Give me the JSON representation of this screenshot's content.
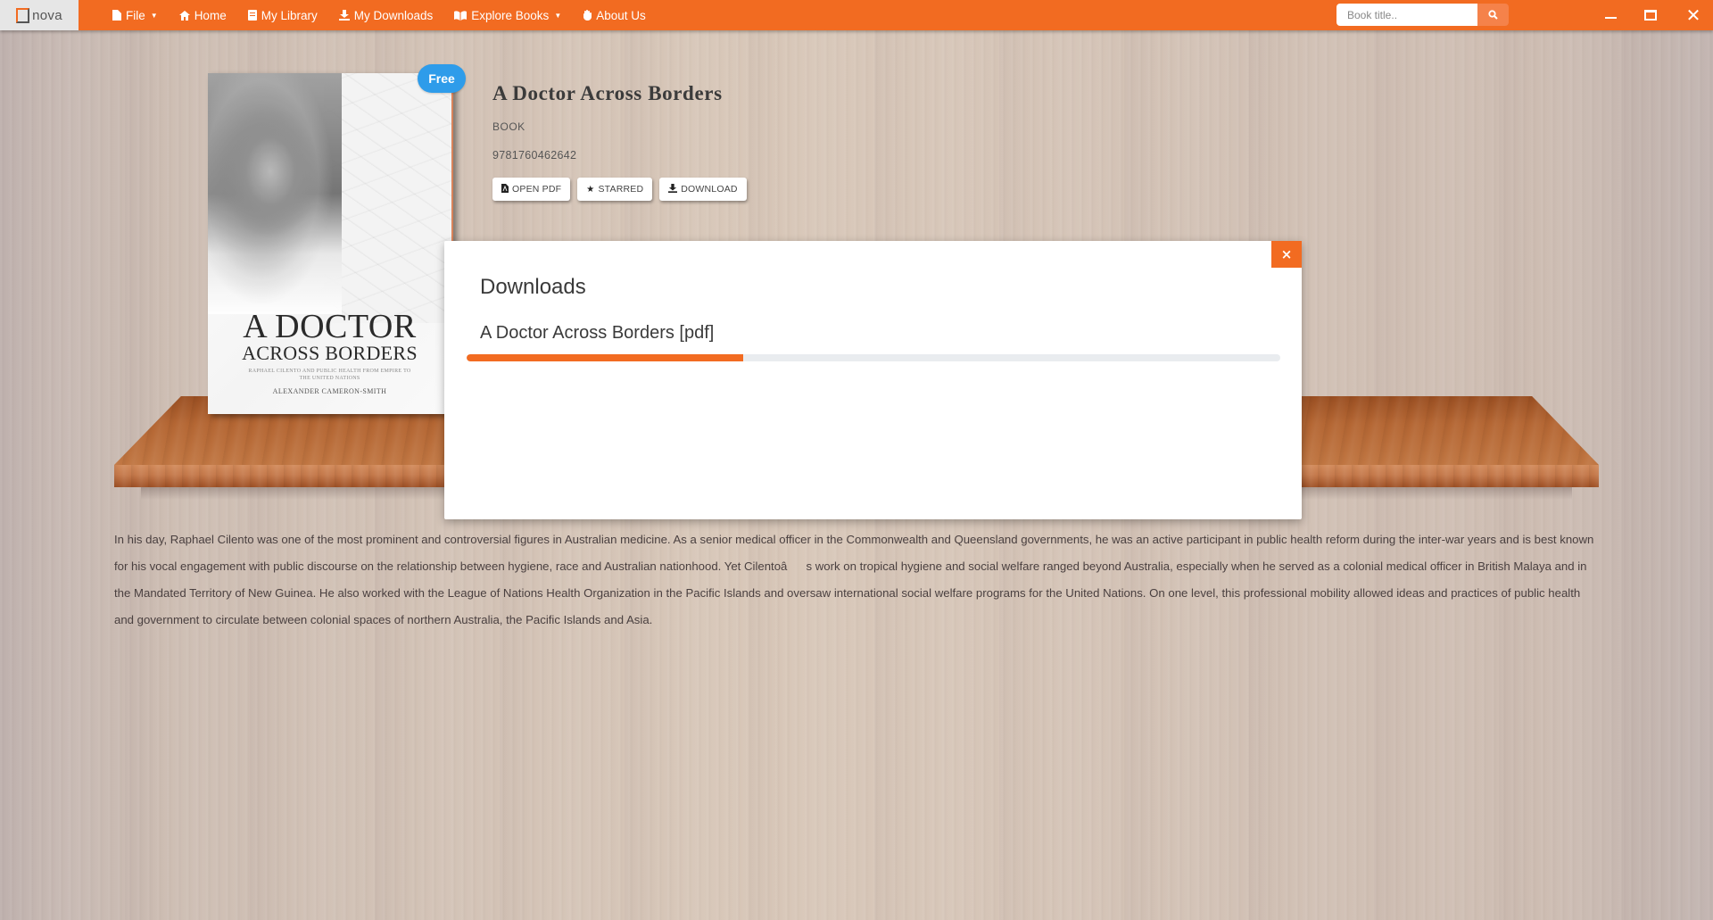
{
  "app": {
    "brand": "nova",
    "accent_color": "#f26b21"
  },
  "nav": {
    "items": [
      {
        "label": "File",
        "icon": "file-icon",
        "dropdown": true
      },
      {
        "label": "Home",
        "icon": "home-icon",
        "dropdown": false
      },
      {
        "label": "My Library",
        "icon": "book-icon",
        "dropdown": false
      },
      {
        "label": "My Downloads",
        "icon": "download-icon",
        "dropdown": false
      },
      {
        "label": "Explore Books",
        "icon": "open-book-icon",
        "dropdown": true
      },
      {
        "label": "About Us",
        "icon": "hand-icon",
        "dropdown": false
      }
    ]
  },
  "search": {
    "placeholder": "Book title..",
    "value": ""
  },
  "book": {
    "badge": "Free",
    "title": "A Doctor Across Borders",
    "type": "BOOK",
    "isbn": "9781760462642",
    "cover": {
      "title_line1": "A DOCTOR",
      "title_line2": "ACROSS BORDERS",
      "subtitle": "RAPHAEL CILENTO AND PUBLIC HEALTH FROM EMPIRE TO THE UNITED NATIONS",
      "author": "ALEXANDER CAMERON-SMITH"
    },
    "actions": {
      "open_pdf": "OPEN PDF",
      "starred": "STARRED",
      "download": "DOWNLOAD"
    },
    "description": "In his day, Raphael Cilento was one of the most prominent and controversial figures in Australian medicine. As a senior medical officer in the Commonwealth and Queensland governments, he was an active participant in public health reform during the inter-war years and is best known for his vocal engagement with public discourse on the relationship between hygiene, race and Australian nationhood. Yet Cilentoâs work on tropical hygiene and social welfare ranged beyond Australia, especially when he served as a colonial medical officer in British Malaya and in the Mandated Territory of New Guinea. He also worked with the League of Nations Health Organization in the Pacific Islands and oversaw international social welfare programs for the United Nations. On one level, this professional mobility allowed ideas and practices of public health and government to circulate between colonial spaces of northern Australia, the Pacific Islands and Asia."
  },
  "downloads_modal": {
    "title": "Downloads",
    "close_label": "×",
    "items": [
      {
        "name": "A Doctor Across Borders [pdf]",
        "progress_percent": 34
      }
    ]
  }
}
